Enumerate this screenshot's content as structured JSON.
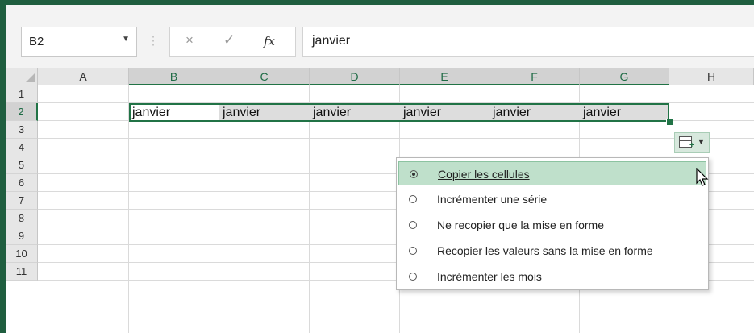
{
  "formula_bar": {
    "name_box": "B2",
    "cancel_icon": "×",
    "enter_icon": "✓",
    "fx_label": "fx",
    "content": "janvier"
  },
  "columns": [
    "A",
    "B",
    "C",
    "D",
    "E",
    "F",
    "G",
    "H"
  ],
  "rows": [
    "1",
    "2",
    "3",
    "4",
    "5",
    "6",
    "7",
    "8",
    "9",
    "10",
    "11"
  ],
  "row2_cells": [
    "janvier",
    "janvier",
    "janvier",
    "janvier",
    "janvier",
    "janvier"
  ],
  "autofill_button": {
    "icon": "autofill-options-icon"
  },
  "autofill_menu": {
    "items": [
      {
        "label": "Copier les cellules",
        "selected": true
      },
      {
        "label": "Incrémenter une série",
        "selected": false
      },
      {
        "label": "Ne recopier que la mise en forme",
        "selected": false
      },
      {
        "label": "Recopier les valeurs sans la mise en forme",
        "selected": false
      },
      {
        "label": "Incrémenter les mois",
        "selected": false
      }
    ]
  },
  "colors": {
    "accent": "#217346",
    "hover": "#bfe0cb",
    "selected_cell": "#dddddd"
  }
}
